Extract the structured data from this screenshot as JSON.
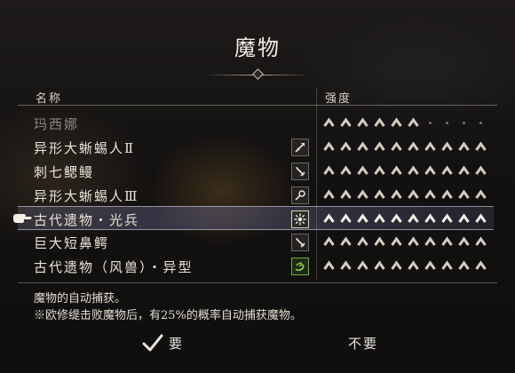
{
  "title": "魔物",
  "columns": {
    "name": "名称",
    "strength": "强度"
  },
  "monsters": [
    {
      "name": "玛西娜",
      "icon": "none",
      "filled": 6,
      "total": 10,
      "dim": true
    },
    {
      "name": "异形大蜥蜴人Ⅱ",
      "icon": "spear-icon",
      "filled": 10,
      "total": 10,
      "dim": false
    },
    {
      "name": "刺七鳃鳗",
      "icon": "sword-icon",
      "filled": 10,
      "total": 10,
      "dim": false
    },
    {
      "name": "异形大蜥蜴人Ⅲ",
      "icon": "staff-icon",
      "filled": 10,
      "total": 10,
      "dim": false
    },
    {
      "name": "古代遗物・光兵",
      "icon": "light-burst-icon",
      "filled": 10,
      "total": 10,
      "dim": false,
      "selected": true
    },
    {
      "name": "巨大短鼻鳄",
      "icon": "sword-icon",
      "filled": 10,
      "total": 10,
      "dim": false
    },
    {
      "name": "古代遗物（风兽）・异型",
      "icon": "wind-icon",
      "filled": 10,
      "total": 10,
      "dim": false
    }
  ],
  "description": {
    "line1": "魔物的自动捕获。",
    "line2": "※欧修缇击败魔物后，有25%的概率自动捕获魔物。"
  },
  "buttons": {
    "yes": "要",
    "no": "不要"
  },
  "colors": {
    "accent": "#d9d2c4",
    "selected": "#8f8fb5",
    "wind": "#6fae3c"
  }
}
